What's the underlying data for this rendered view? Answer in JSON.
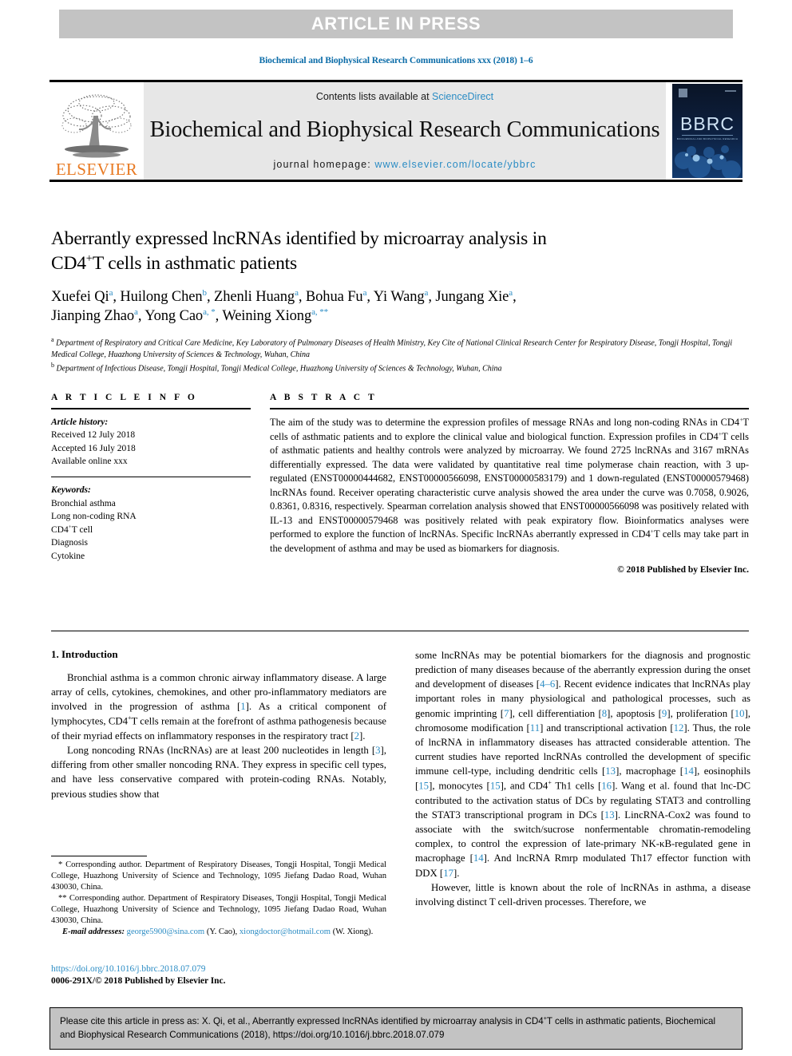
{
  "banner": {
    "text": "ARTICLE IN PRESS"
  },
  "running_head": {
    "text": "Biochemical and Biophysical Research Communications xxx (2018) 1–6"
  },
  "masthead": {
    "contents_prefix": "Contents lists available at ",
    "contents_link": "ScienceDirect",
    "journal_title": "Biochemical and Biophysical Research Communications",
    "homepage_prefix": "journal homepage: ",
    "homepage_link": "www.elsevier.com/locate/ybbrc",
    "publisher_logo_text": "ELSEVIER",
    "cover_text": "BBRC",
    "cover_subtext": "BIOCHEMICAL AND BIOPHYSICAL RESEARCH COMMUNICATIONS"
  },
  "article": {
    "title_line1": "Aberrantly expressed lncRNAs identified by microarray analysis in",
    "title_line2_pre": "CD4",
    "title_line2_sup": "+",
    "title_line2_post": "T cells in asthmatic patients",
    "authors": [
      {
        "name": "Xuefei Qi",
        "mark": "a",
        "mark_extra": ""
      },
      {
        "name": "Huilong Chen",
        "mark": "b",
        "mark_extra": ""
      },
      {
        "name": "Zhenli Huang",
        "mark": "a",
        "mark_extra": ""
      },
      {
        "name": "Bohua Fu",
        "mark": "a",
        "mark_extra": ""
      },
      {
        "name": "Yi Wang",
        "mark": "a",
        "mark_extra": ""
      },
      {
        "name": "Jungang Xie",
        "mark": "a",
        "mark_extra": ""
      },
      {
        "name": "Jianping Zhao",
        "mark": "a",
        "mark_extra": ""
      },
      {
        "name": "Yong Cao",
        "mark": "a",
        "mark_extra": ", *"
      },
      {
        "name": "Weining Xiong",
        "mark": "a",
        "mark_extra": ", **"
      }
    ],
    "affiliation_a": "Department of Respiratory and Critical Care Medicine, Key Laboratory of Pulmonary Diseases of Health Ministry, Key Cite of National Clinical Research Center for Respiratory Disease, Tongji Hospital, Tongji Medical College, Huazhong University of Sciences & Technology, Wuhan, China",
    "affiliation_b": "Department of Infectious Disease, Tongji Hospital, Tongji Medical College, Huazhong University of Sciences & Technology, Wuhan, China",
    "affiliation_a_label": "a",
    "affiliation_b_label": "b"
  },
  "article_info": {
    "heading": "A R T I C L E   I N F O",
    "history_label": "Article history:",
    "received": "Received 12 July 2018",
    "accepted": "Accepted 16 July 2018",
    "available": "Available online xxx",
    "keywords_label": "Keywords:",
    "keywords": [
      "Bronchial asthma",
      "Long non-coding RNA",
      "CD4+T cell",
      "Diagnosis",
      "Cytokine"
    ]
  },
  "abstract": {
    "heading": "A B S T R A C T",
    "part1": "The aim of the study was to determine the expression profiles of message RNAs and long non-coding RNAs in CD4",
    "sup1": "+",
    "part2": "T cells of asthmatic patients and to explore the clinical value and biological function. Expression profiles in CD4",
    "sup2": "+",
    "part3": "T cells of asthmatic patients and healthy controls were analyzed by microarray. We found 2725 lncRNAs and 3167 mRNAs differentially expressed. The data were validated by quantitative real time polymerase chain reaction, with 3 up-regulated (ENST00000444682, ENST00000566098, ENST00000583179) and 1 down-regulated (ENST00000579468) lncRNAs found. Receiver operating characteristic curve analysis showed the area under the curve was 0.7058, 0.9026, 0.8361, 0.8316, respectively. Spearman correlation analysis showed that ENST00000566098 was positively related with IL-13 and ENST00000579468 was positively related with peak expiratory flow. Bioinformatics analyses were performed to explore the function of lncRNAs. Specific lncRNAs aberrantly expressed in CD4",
    "sup3": "+",
    "part4": "T cells may take part in the development of asthma and may be used as biomarkers for diagnosis.",
    "copyright": "© 2018 Published by Elsevier Inc."
  },
  "intro": {
    "heading": "1.  Introduction",
    "left_p1_a": "Bronchial asthma is a common chronic airway inflammatory disease. A large array of cells, cytokines, chemokines, and other pro-inflammatory mediators are involved in the progression of asthma [",
    "left_p1_r1": "1",
    "left_p1_b": "]. As a critical component of lymphocytes, CD4",
    "left_p1_sup": "+",
    "left_p1_c": "T cells remain at the forefront of asthma pathogenesis because of their myriad effects on inflammatory responses in the respiratory tract [",
    "left_p1_r2": "2",
    "left_p1_d": "].",
    "left_p2_a": "Long noncoding RNAs (lncRNAs) are at least 200 nucleotides in length [",
    "left_p2_r1": "3",
    "left_p2_b": "], differing from other smaller noncoding RNA. They express in specific cell types, and have less conservative compared with protein-coding RNAs. Notably, previous studies show that",
    "right_p1_a": "some lncRNAs may be potential biomarkers for the diagnosis and prognostic prediction of many diseases because of the aberrantly expression during the onset and development of diseases [",
    "right_p1_r1": "4–6",
    "right_p1_b": "]. Recent evidence indicates that lncRNAs play important roles in many physiological and pathological processes, such as genomic imprinting [",
    "right_p1_r2": "7",
    "right_p1_c": "], cell differentiation [",
    "right_p1_r3": "8",
    "right_p1_d": "], apoptosis [",
    "right_p1_r4": "9",
    "right_p1_e": "], proliferation [",
    "right_p1_r5": "10",
    "right_p1_f": "], chromosome modification [",
    "right_p1_r6": "11",
    "right_p1_g": "] and transcriptional activation [",
    "right_p1_r7": "12",
    "right_p1_h": "]. Thus, the role of lncRNA in inflammatory diseases has attracted considerable attention. The current studies have reported lncRNAs controlled the development of specific immune cell-type, including dendritic cells [",
    "right_p1_r8": "13",
    "right_p1_i": "], macrophage [",
    "right_p1_r9": "14",
    "right_p1_j": "], eosinophils [",
    "right_p1_r10": "15",
    "right_p1_k": "], monocytes [",
    "right_p1_r11": "15",
    "right_p1_l": "], and CD4",
    "right_p1_sup": "+",
    "right_p1_m": " Th1 cells [",
    "right_p1_r12": "16",
    "right_p1_n": "]. Wang et al. found that lnc-DC contributed to the activation status of DCs by regulating STAT3 and controlling the STAT3 transcriptional program in DCs [",
    "right_p1_r13": "13",
    "right_p1_o": "]. LincRNA-Cox2 was found to associate with the switch/sucrose nonfermentable chromatin-remodeling complex, to control the expression of late-primary NK-κB-regulated gene in macrophage [",
    "right_p1_r14": "14",
    "right_p1_p": "]. And lncRNA Rmrp modulated Th17 effector function with DDX [",
    "right_p1_r15": "17",
    "right_p1_q": "].",
    "right_p2": "However, little is known about the role of lncRNAs in asthma, a disease involving distinct T cell-driven processes. Therefore, we"
  },
  "footnotes": {
    "corr1_mark": "*",
    "corr1": "Corresponding author. Department of Respiratory Diseases, Tongji Hospital, Tongji Medical College, Huazhong University of Science and Technology, 1095 Jiefang Dadao Road, Wuhan 430030, China.",
    "corr2_mark": "**",
    "corr2": "Corresponding author. Department of Respiratory Diseases, Tongji Hospital, Tongji Medical College, Huazhong University of Science and Technology, 1095 Jiefang Dadao Road, Wuhan 430030, China.",
    "email_label": "E-mail addresses:",
    "email1": "george5900@sina.com",
    "email1_who": "(Y. Cao),",
    "email2": "xiongdoctor@hotmail.com",
    "email2_who": "(W. Xiong)."
  },
  "doi_block": {
    "doi": "https://doi.org/10.1016/j.bbrc.2018.07.079",
    "issn": "0006-291X/© 2018 Published by Elsevier Inc."
  },
  "cite_box": {
    "line_a": "Please cite this article in press as: X. Qi, et al., Aberrantly expressed lncRNAs identified by microarray analysis in CD4",
    "sup": "+",
    "line_b": "T cells in asthmatic patients, Biochemical and Biophysical Research Communications (2018), https://doi.org/10.1016/j.bbrc.2018.07.079"
  },
  "colors": {
    "link_blue": "#2b8cc4",
    "header_blue": "#0b6ca8",
    "band_gray": "#c3c3c3",
    "mast_gray": "#e7e7e7",
    "elsevier_orange": "#e87a23"
  }
}
